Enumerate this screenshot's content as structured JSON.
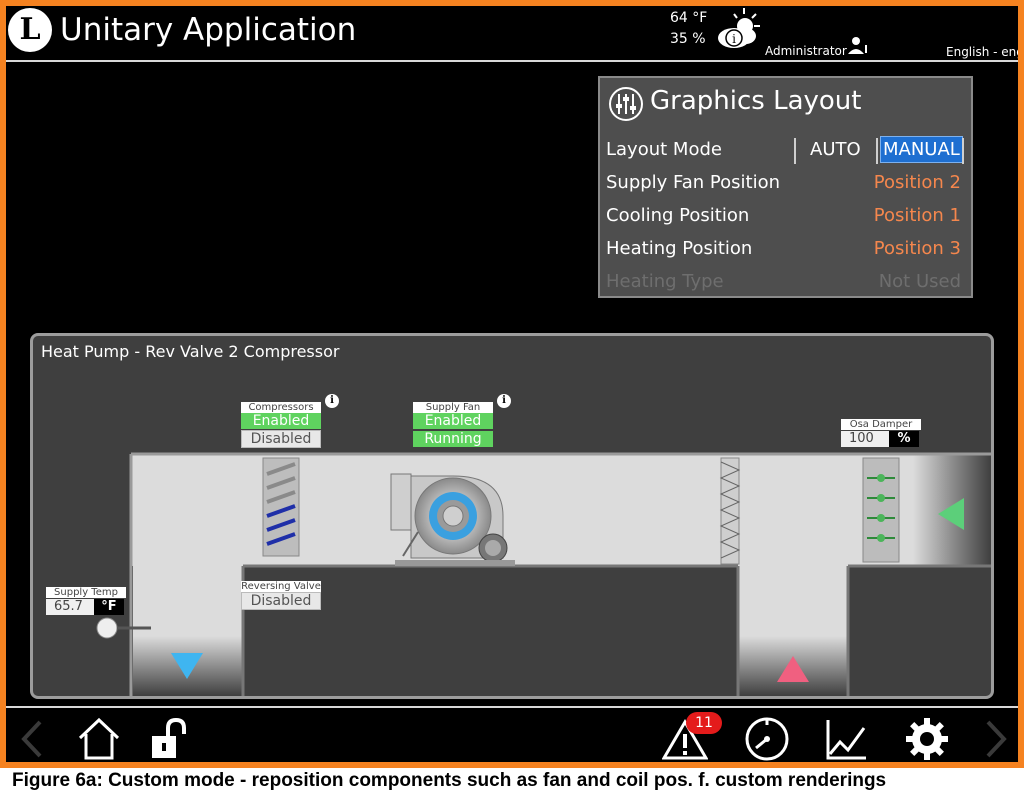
{
  "header": {
    "logo_letter": "L",
    "title": "Unitary Application",
    "temperature": "64 °F",
    "humidity": "35 %",
    "user": "Administrator",
    "language": "English - eng",
    "weather_icon": "weather-sun-cloud-info-icon",
    "user_icon": "user-info-icon"
  },
  "graphics_layout": {
    "title": "Graphics Layout",
    "icon": "sliders-icon",
    "layout_mode_label": "Layout Mode",
    "mode_auto": "AUTO",
    "mode_manual": "MANUAL",
    "selected_mode": "MANUAL",
    "rows": [
      {
        "label": "Supply Fan Position",
        "value": "Position 2"
      },
      {
        "label": "Cooling Position",
        "value": "Position 1"
      },
      {
        "label": "Heating Position",
        "value": "Position 3"
      },
      {
        "label": "Heating Type",
        "value": "Not Used",
        "disabled": true
      }
    ]
  },
  "equipment": {
    "title": "Heat Pump - Rev Valve 2 Compressor",
    "compressors": {
      "tag": "Compressors",
      "status1": "Enabled",
      "status2": "Disabled"
    },
    "supply_fan": {
      "tag": "Supply Fan",
      "status1": "Enabled",
      "status2": "Running"
    },
    "osa_damper": {
      "tag": "Osa Damper",
      "value": "100",
      "unit": "%"
    },
    "reversing_valve": {
      "tag": "Reversing Valve",
      "status": "Disabled"
    },
    "supply_temp": {
      "tag": "Supply Temp",
      "value": "65.7",
      "unit": "°F"
    },
    "info_symbol": "i"
  },
  "footer": {
    "alarm_count": "11",
    "icons": [
      "back-arrow-icon",
      "home-icon",
      "unlock-icon",
      "alarm-icon",
      "gauge-icon",
      "trend-chart-icon",
      "settings-gear-icon",
      "forward-arrow-icon"
    ]
  },
  "caption": "Figure 6a:  Custom mode - reposition components such as fan and coil pos.  f. custom renderings",
  "colors": {
    "frame": "#f58220",
    "accent_value": "#f5874d",
    "manual_selected": "#1e6fd1",
    "status_green": "#5fd35f",
    "supply_arrow": "#3fb5f0",
    "return_arrow": "#f06080",
    "intake_arrow": "#5ccf7a"
  }
}
